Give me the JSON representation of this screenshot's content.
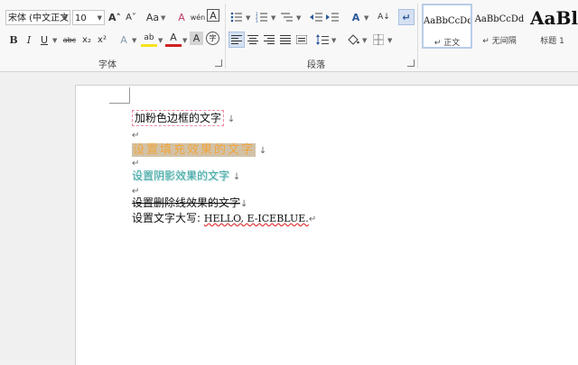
{
  "font_group": {
    "font_name": "宋体 (中文正文)",
    "font_size": "10",
    "label": "字体",
    "row1_glyphs": {
      "grow": "A˄",
      "shrink": "A˅",
      "change_case": "Aa",
      "clear_format": "A",
      "phonetic": "wén",
      "char_border": "A"
    },
    "row2_glyphs": {
      "bold": "B",
      "italic": "I",
      "underline": "U",
      "strike": "abc",
      "subscript": "x₂",
      "superscript": "x²",
      "effects": "A",
      "highlight": "ab",
      "font_color": "A",
      "char_shading": "A",
      "enclose": "字"
    }
  },
  "para_group": {
    "label": "段落",
    "sort": "A↓",
    "asian_layout": "A"
  },
  "styles": [
    {
      "sample": "AaBbCcDd",
      "name": "↵ 正文"
    },
    {
      "sample": "AaBbCcDd",
      "name": "↵ 无间隔"
    },
    {
      "sample": "AaBl",
      "name": "标题 1"
    }
  ],
  "colors": {
    "highlight": "#f5e21b",
    "font_color": "#d02020",
    "accent": "#2b579a"
  },
  "document": {
    "line1": "加粉色边框的文字",
    "line2": "设置填充效果的文字",
    "line3": "设置阴影效果的文字",
    "line4": "设置删除线效果的文字",
    "line5_prefix": "设置文字大写:",
    "line5_value": "HELLO, E-ICEBLUE.",
    "para_mark": "↵",
    "line_mark": "↓"
  }
}
